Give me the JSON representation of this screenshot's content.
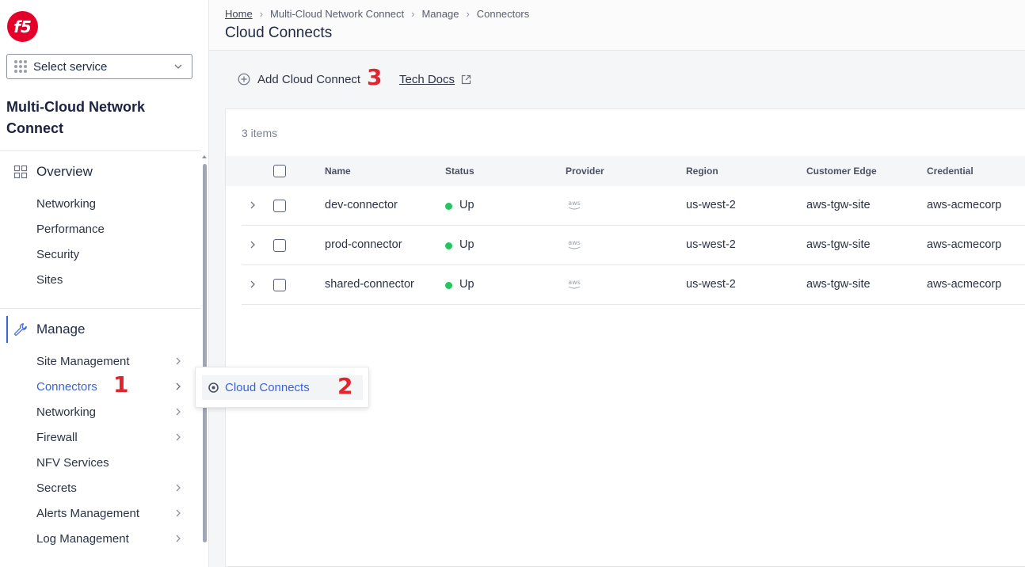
{
  "sidebar": {
    "service_select": "Select service",
    "app_title": "Multi-Cloud Network Connect",
    "overview": {
      "label": "Overview",
      "items": [
        {
          "label": "Networking"
        },
        {
          "label": "Performance"
        },
        {
          "label": "Security"
        },
        {
          "label": "Sites"
        }
      ]
    },
    "manage": {
      "label": "Manage",
      "items": [
        {
          "label": "Site Management"
        },
        {
          "label": "Connectors"
        },
        {
          "label": "Networking"
        },
        {
          "label": "Firewall"
        },
        {
          "label": "NFV Services"
        },
        {
          "label": "Secrets"
        },
        {
          "label": "Alerts Management"
        },
        {
          "label": "Log Management"
        }
      ]
    }
  },
  "flyout": {
    "item": "Cloud Connects"
  },
  "annotations": {
    "n1": "1",
    "n2": "2",
    "n3": "3"
  },
  "breadcrumb": [
    "Home",
    "Multi-Cloud Network Connect",
    "Manage",
    "Connectors"
  ],
  "page_title": "Cloud Connects",
  "actions": {
    "add": "Add Cloud Connect",
    "docs": "Tech Docs"
  },
  "table": {
    "count": "3 items",
    "columns": [
      "Name",
      "Status",
      "Provider",
      "Region",
      "Customer Edge",
      "Credential"
    ],
    "rows": [
      {
        "name": "dev-connector",
        "status": "Up",
        "provider": "aws",
        "region": "us-west-2",
        "edge": "aws-tgw-site",
        "credential": "aws-acmecorp"
      },
      {
        "name": "prod-connector",
        "status": "Up",
        "provider": "aws",
        "region": "us-west-2",
        "edge": "aws-tgw-site",
        "credential": "aws-acmecorp"
      },
      {
        "name": "shared-connector",
        "status": "Up",
        "provider": "aws",
        "region": "us-west-2",
        "edge": "aws-tgw-site",
        "credential": "aws-acmecorp"
      }
    ]
  },
  "colors": {
    "accent": "#3b63d9",
    "annotation": "#e0252f",
    "status_up": "#22c55e",
    "logo": "#e4002b"
  }
}
